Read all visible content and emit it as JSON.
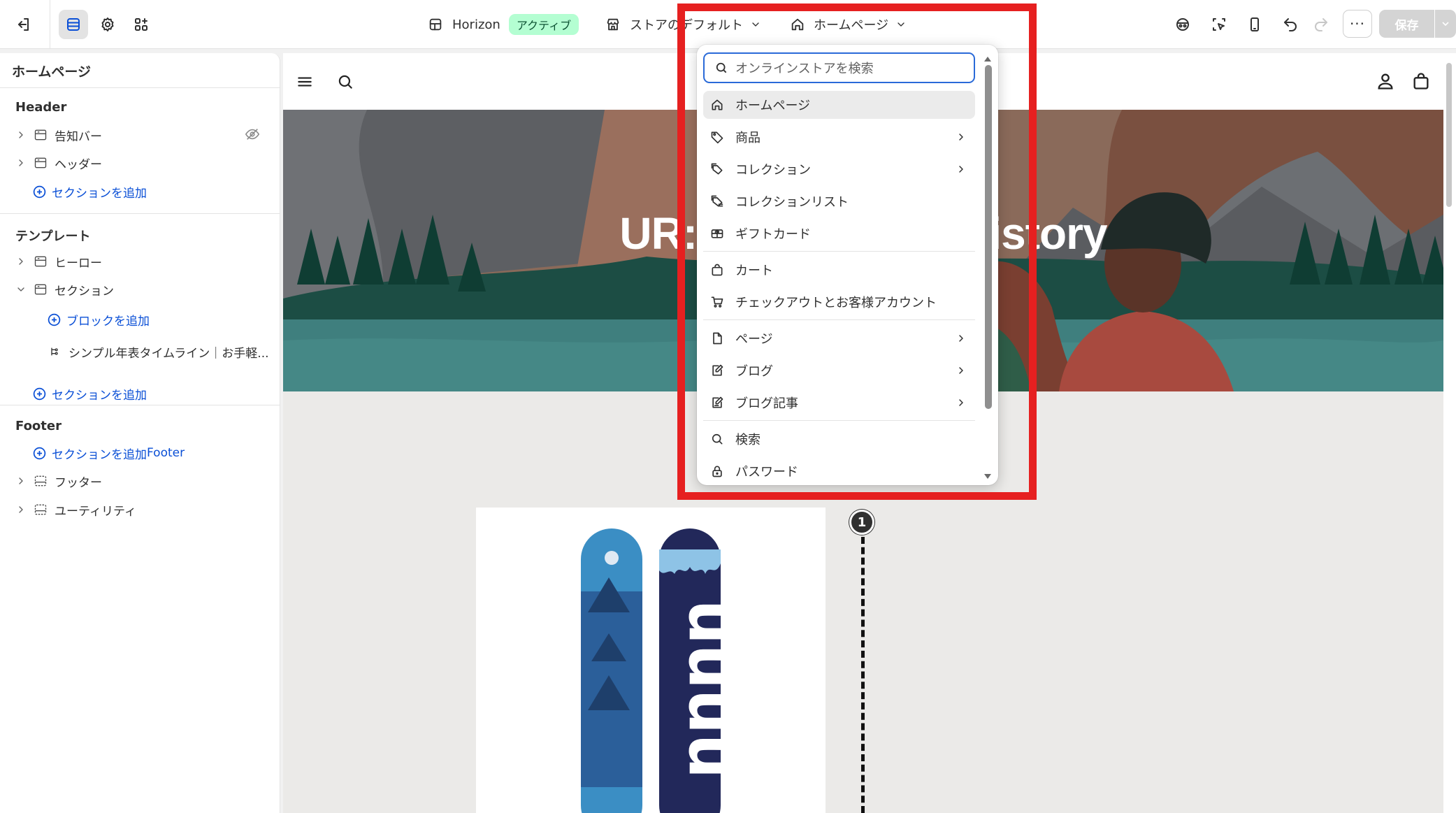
{
  "topbar": {
    "theme_name": "Horizon",
    "theme_status": "アクティブ",
    "store_default": "ストアのデフォルト",
    "page_selector": "ホームページ",
    "save_label": "保存",
    "more_label": "···"
  },
  "sidebar": {
    "title": "ホームページ",
    "header_group": "Header",
    "header_items": [
      "告知バー",
      "ヘッダー"
    ],
    "add_section": "セクションを追加",
    "template_group": "テンプレート",
    "template_items": [
      "ヒーロー",
      "セクション"
    ],
    "add_block": "ブロックを追加",
    "block_item": "シンプル年表タイムライン｜お手軽...",
    "footer_group": "Footer",
    "footer_items": [
      "フッター",
      "ユーティリティ"
    ]
  },
  "preview": {
    "hero_title": "UR: Snowboard History",
    "timeline_marker": "1"
  },
  "dropdown": {
    "search_placeholder": "オンラインストアを検索",
    "items": [
      {
        "label": "ホームページ",
        "icon": "home-icon",
        "selected": true,
        "has_submenu": false
      },
      {
        "label": "商品",
        "icon": "tag-icon",
        "selected": false,
        "has_submenu": true
      },
      {
        "label": "コレクション",
        "icon": "collection-icon",
        "selected": false,
        "has_submenu": true
      },
      {
        "label": "コレクションリスト",
        "icon": "collection-list-icon",
        "selected": false,
        "has_submenu": false
      },
      {
        "label": "ギフトカード",
        "icon": "gift-card-icon",
        "selected": false,
        "has_submenu": false
      },
      {
        "label": "カート",
        "icon": "bag-icon",
        "selected": false,
        "has_submenu": false
      },
      {
        "label": "チェックアウトとお客様アカウント",
        "icon": "cart-icon",
        "selected": false,
        "has_submenu": false
      },
      {
        "label": "ページ",
        "icon": "page-icon",
        "selected": false,
        "has_submenu": true
      },
      {
        "label": "ブログ",
        "icon": "blog-icon",
        "selected": false,
        "has_submenu": true
      },
      {
        "label": "ブログ記事",
        "icon": "blog-post-icon",
        "selected": false,
        "has_submenu": true
      },
      {
        "label": "検索",
        "icon": "search-icon",
        "selected": false,
        "has_submenu": false
      },
      {
        "label": "パスワード",
        "icon": "lock-icon",
        "selected": false,
        "has_submenu": false
      }
    ]
  },
  "colors": {
    "accent": "#0a4fd6",
    "badge_bg": "#b4fed2",
    "highlight": "#e62020"
  }
}
